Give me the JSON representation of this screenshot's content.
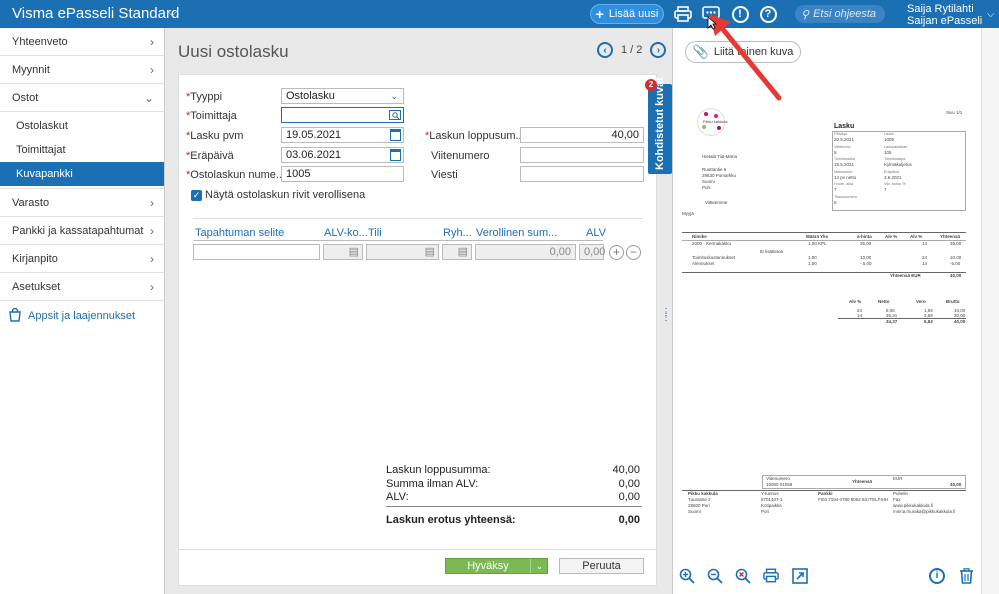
{
  "app": {
    "title": "Visma ePasseli Standard"
  },
  "topbar": {
    "add_button": "Lisää uusi",
    "search_placeholder": "Etsi ohjeesta",
    "user_name": "Saija Rytilahti",
    "company": "Saijan ePasseli"
  },
  "sidebar": {
    "items": [
      {
        "label": "Yhteenveto"
      },
      {
        "label": "Myynnit"
      },
      {
        "label": "Ostot"
      },
      {
        "label": "Varasto"
      },
      {
        "label": "Pankki ja kassatapahtumat"
      },
      {
        "label": "Kirjanpito"
      },
      {
        "label": "Asetukset"
      }
    ],
    "subitems": [
      {
        "label": "Ostolaskut"
      },
      {
        "label": "Toimittajat"
      },
      {
        "label": "Kuvapankki"
      }
    ],
    "apps_label": "Appsit ja laajennukset"
  },
  "page": {
    "title": "Uusi ostolasku",
    "pager": "1 / 2"
  },
  "form": {
    "type_label": "Tyyppi",
    "type_value": "Ostolasku",
    "supplier_label": "Toimittaja",
    "supplier_value": "",
    "date_label": "Lasku pvm",
    "date_value": "19.05.2021",
    "due_label": "Eräpäivä",
    "due_value": "03.06.2021",
    "number_label": "Ostolaskun nume...",
    "number_value": "1005",
    "total_label": "Laskun loppusum...",
    "total_value": "40,00",
    "reference_label": "Viitenumero",
    "reference_value": "",
    "message_label": "Viesti",
    "message_value": "",
    "show_rows_label": "Näytä ostolaskun rivit verollisena"
  },
  "table": {
    "headers": [
      "Tapahtuman selite",
      "ALV-ko...",
      "Tili",
      "Ryh...",
      "Verollinen sum...",
      "ALV"
    ],
    "row": {
      "amount": "0,00",
      "vat": "0,00"
    }
  },
  "summary": {
    "rows": [
      {
        "label": "Laskun loppusumma:",
        "value": "40,00"
      },
      {
        "label": "Summa ilman ALV:",
        "value": "0,00"
      },
      {
        "label": "ALV:",
        "value": "0,00"
      }
    ],
    "difference_label": "Laskun erotus yhteensä:",
    "difference_value": "0,00"
  },
  "actions": {
    "approve": "Hyväksy",
    "cancel": "Peruuta"
  },
  "side_tab": {
    "label": "Kohdistetut kuvat",
    "badge": "2"
  },
  "document": {
    "attach_button": "Liitä toinen kuva",
    "invoice": {
      "page": "Sivu 1/1",
      "title": "Lasku",
      "logo_text": "Pikku kakkula",
      "customer": [
        "Hietala Tiia-Maria",
        "Ruuttantie 6",
        "29630 Pomarkku",
        "Suomi",
        "Puh."
      ],
      "fields": [
        {
          "k": "Päiväys",
          "v": "20.5.2021"
        },
        {
          "k": "Lasku",
          "v": "1005"
        },
        {
          "k": "Viitekunto",
          "v": "5"
        },
        {
          "k": "Laskuasiakas",
          "v": "105"
        },
        {
          "k": "Toimitusaika",
          "v": "19.5.2021"
        },
        {
          "k": "Toimitustapa",
          "v": "Kylmäkuljetus"
        },
        {
          "k": "Maksuehto",
          "v": "14 pv netto"
        },
        {
          "k": "Eräpäivä",
          "v": "3.6.2021"
        },
        {
          "k": "Huom. aika",
          "v": "7"
        },
        {
          "k": "Viiv. korko %",
          "v": "7"
        },
        {
          "k": "Tilausnumero",
          "v": "5"
        }
      ],
      "ref_label": "Viitteemme",
      "buyer_label": "Myyjä",
      "columns": [
        "Nimike",
        "Määrä Yks",
        "à-hinta",
        "Ale %",
        "Alv %",
        "Yhteensä"
      ],
      "lines": [
        [
          "2000 - Kermakakku",
          "1,00 KPL",
          "35,00",
          "",
          "14",
          "35,00"
        ],
        [
          "Toimituskustannukset",
          "1,00",
          "10,00",
          "",
          "24",
          "10,00"
        ],
        [
          "Alennukset",
          "1,00",
          "- 5,00",
          "",
          "14",
          "-5,00"
        ]
      ],
      "lines_note": "Ei lisätietoa",
      "lines_total_label": "Yhteensä EUR",
      "lines_total": "40,00",
      "vat_columns": [
        "Alv %",
        "Netto",
        "Vero",
        "Brutto"
      ],
      "vat_rows": [
        [
          "24",
          "8,06",
          "1,94",
          "10,00"
        ],
        [
          "14",
          "26,31",
          "3,69",
          "30,00"
        ]
      ],
      "vat_total": [
        "",
        "34,37",
        "5,63",
        "40,00"
      ],
      "footer_ref_label": "Viitenumero",
      "footer_ref": "10050 01058",
      "footer_total_label": "Yhteensä",
      "footer_eur": "EUR",
      "footer_total": "40,00",
      "footer_info": [
        "Pikku kakkula",
        "Tuurantie 2",
        "28600 Pori",
        "Suomi",
        "Y-tunnus",
        "8701407-1",
        "Kotipaikka",
        "Pori",
        "Pankki",
        "FI03 7194 0780 6052 53 ITELFIHH",
        "Puhelin",
        "Fax",
        "www.pikkukakkula.fi",
        "minna.muraka@pikkukakkula.fi"
      ]
    }
  },
  "colors": {
    "brand": "#1b6fb3",
    "approve": "#7cb954",
    "badge": "#d32f2f",
    "annotation_arrow": "#e53935"
  }
}
